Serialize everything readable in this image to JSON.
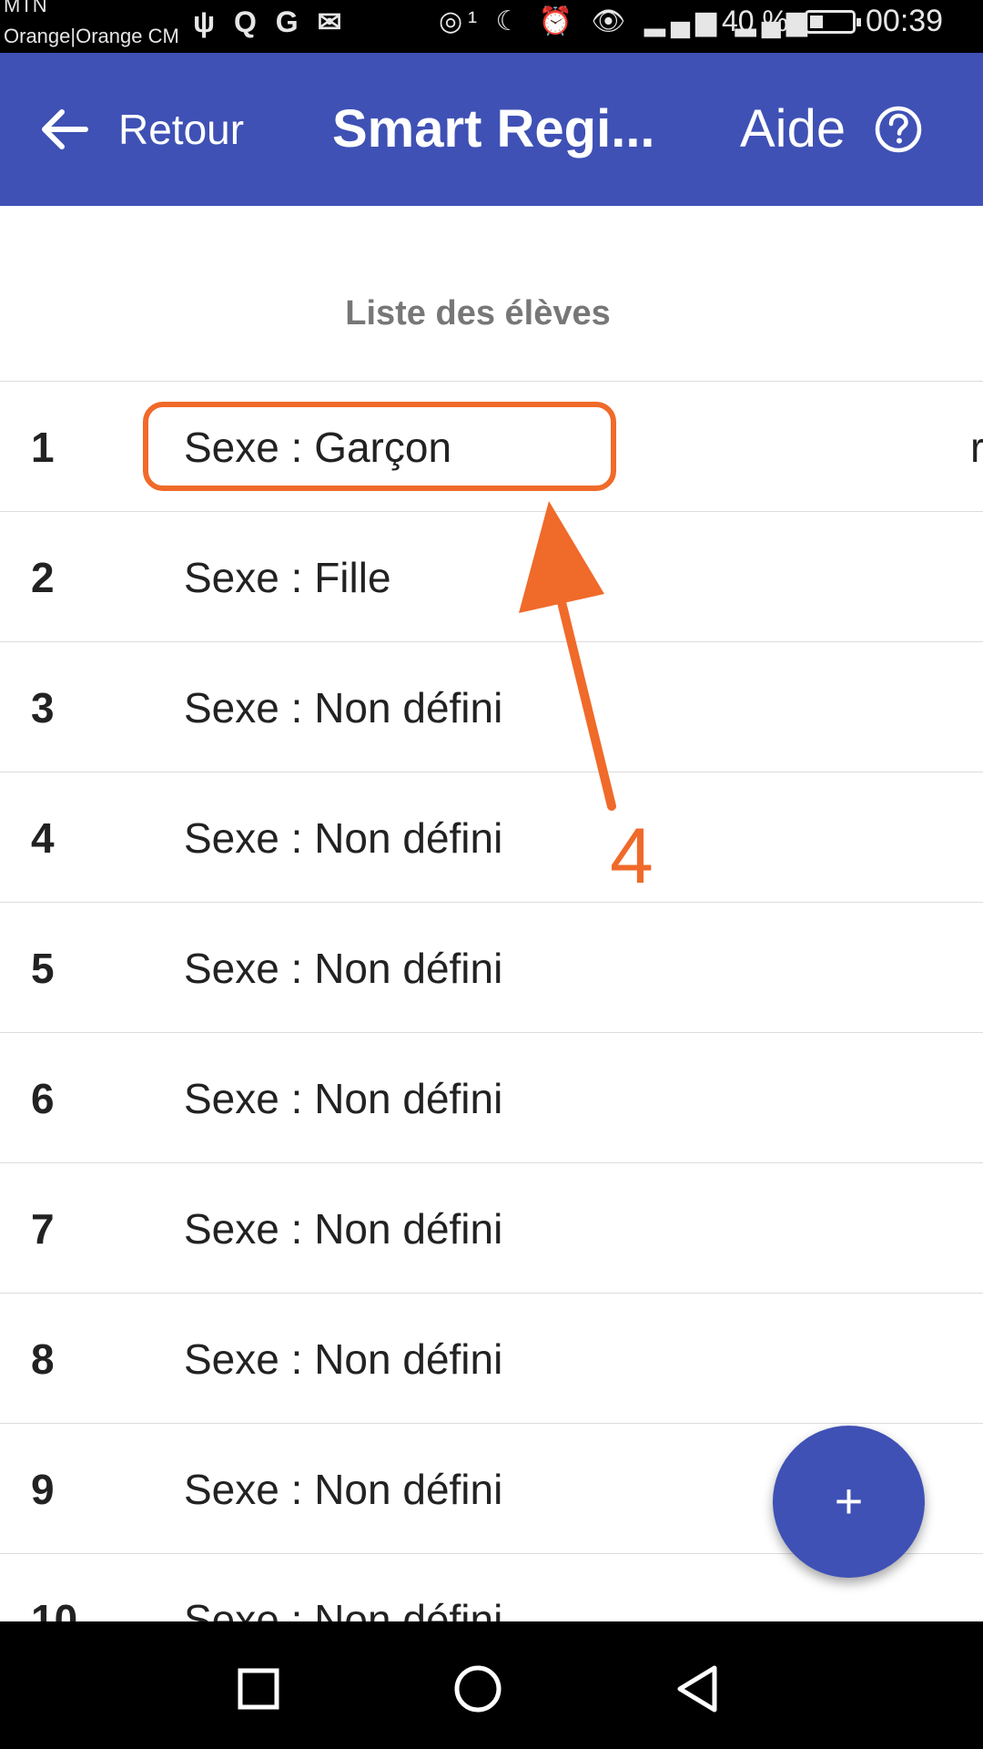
{
  "status_bar": {
    "carrier_line1": "MTN",
    "carrier_line2": "Orange|Orange CM",
    "left_icons": "ψ Q G ✉",
    "right_icons": "◎¹ ☾ ⏰ 👁 ▂▄▆ ▂▄▆",
    "battery_percent": "40 %",
    "battery_level": 0.4,
    "time": "00:39"
  },
  "app_bar": {
    "back_label": "Retour",
    "title": "Smart Regi...",
    "help_label": "Aide",
    "color": "#3f51b5"
  },
  "list": {
    "title": "Liste des élèves",
    "rows": [
      {
        "number": "1",
        "sex": "Sexe : Garçon",
        "edge": "r"
      },
      {
        "number": "2",
        "sex": "Sexe : Fille"
      },
      {
        "number": "3",
        "sex": "Sexe : Non défini"
      },
      {
        "number": "4",
        "sex": "Sexe : Non défini"
      },
      {
        "number": "5",
        "sex": "Sexe : Non défini"
      },
      {
        "number": "6",
        "sex": "Sexe : Non défini"
      },
      {
        "number": "7",
        "sex": "Sexe : Non défini"
      },
      {
        "number": "8",
        "sex": "Sexe : Non défini"
      },
      {
        "number": "9",
        "sex": "Sexe : Non défini"
      },
      {
        "number": "10",
        "sex": "Sexe : Non défini"
      }
    ]
  },
  "annotation": {
    "step_number": "4",
    "color": "#f06a2a"
  },
  "fab": {
    "label": "+"
  },
  "icons": {
    "back": "arrow-left-icon",
    "help": "question-circle-icon",
    "nav_recents": "square-icon",
    "nav_home": "circle-icon",
    "nav_back": "triangle-back-icon"
  }
}
